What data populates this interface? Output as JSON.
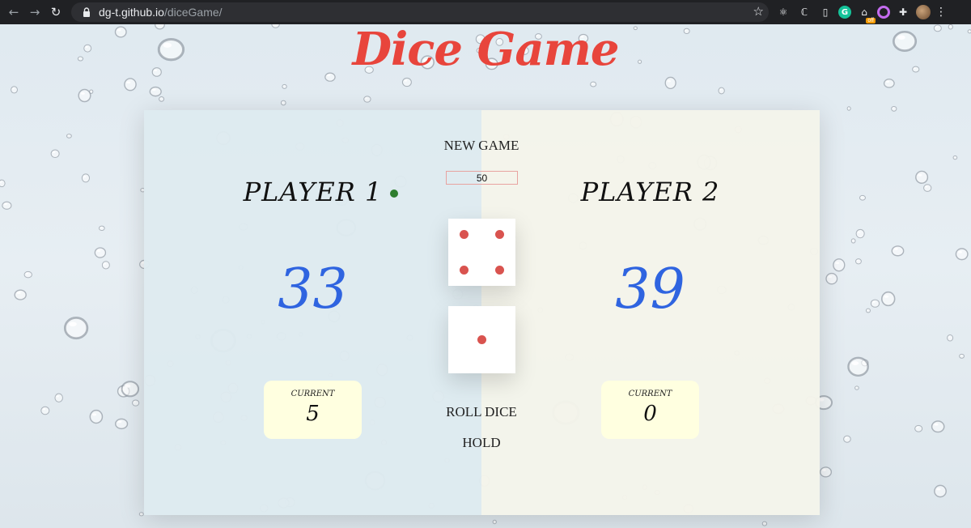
{
  "browser": {
    "url_host": "dg-t.github.io",
    "url_path": "/diceGame/",
    "extension_badge": "off"
  },
  "game": {
    "title": "Dice Game",
    "new_game_label": "NEW GAME",
    "target_score": "50",
    "roll_label": "ROLL DICE",
    "hold_label": "HOLD",
    "active_player": 1,
    "dice": [
      4,
      1
    ],
    "players": [
      {
        "name": "PLAYER 1",
        "score": "33",
        "current_label": "CURRENT",
        "current": "5"
      },
      {
        "name": "PLAYER 2",
        "score": "39",
        "current_label": "CURRENT",
        "current": "0"
      }
    ]
  },
  "colors": {
    "title": "#e8453c",
    "score": "#2f64e0",
    "pip": "#d9534f",
    "active_dot": "#2e7d2e",
    "player1_panel": "#deeaf0",
    "player2_panel": "#f4f4ea",
    "current_box": "#ffffe0"
  },
  "icons": [
    "back-arrow-icon",
    "forward-arrow-icon",
    "reload-icon",
    "lock-icon",
    "star-icon",
    "extension-puzzle-icon",
    "menu-kebab-icon"
  ]
}
